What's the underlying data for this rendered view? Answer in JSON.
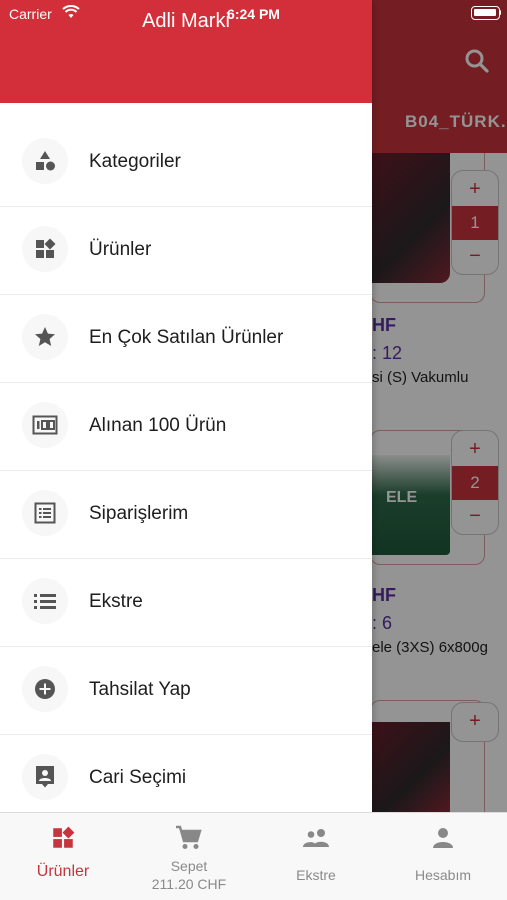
{
  "status_bar": {
    "carrier": "Carrier",
    "time": "6:24 PM"
  },
  "drawer": {
    "title": "Adli Marki",
    "items": [
      {
        "label": "Kategoriler",
        "icon": "shapes-icon"
      },
      {
        "label": "Ürünler",
        "icon": "widgets-icon"
      },
      {
        "label": "En Çok Satılan Ürünler",
        "icon": "star-icon"
      },
      {
        "label": "Alınan 100 Ürün",
        "icon": "counter-100-icon"
      },
      {
        "label": "Siparişlerim",
        "icon": "list-alt-icon"
      },
      {
        "label": "Ekstre",
        "icon": "list-icon"
      },
      {
        "label": "Tahsilat Yap",
        "icon": "add-circle-icon"
      },
      {
        "label": "Cari Seçimi",
        "icon": "contact-card-icon"
      }
    ]
  },
  "background": {
    "tab_label": "B04_TÜRK.-",
    "products": [
      {
        "quantity": "1",
        "price_fragment": "HF",
        "stock_fragment": ": 12",
        "name_fragment": "si (S) Vakumlu"
      },
      {
        "quantity": "2",
        "price_fragment": "HF",
        "stock_fragment": ": 6",
        "name_fragment": "ele (3XS) 6x800g",
        "brand_fragment": "ELE"
      },
      {
        "quantity": ""
      }
    ],
    "stepper_plus": "+",
    "stepper_minus": "−"
  },
  "tabbar": {
    "tabs": [
      {
        "label": "Ürünler",
        "icon": "widgets-icon",
        "active": true
      },
      {
        "label": "Sepet",
        "sub": "211.20 CHF",
        "icon": "cart-icon"
      },
      {
        "label": "Ekstre",
        "icon": "people-icon"
      },
      {
        "label": "Hesabım",
        "icon": "person-icon"
      }
    ]
  },
  "colors": {
    "brand_red": "#d22f3a",
    "price_purple": "#5a2fa0"
  }
}
